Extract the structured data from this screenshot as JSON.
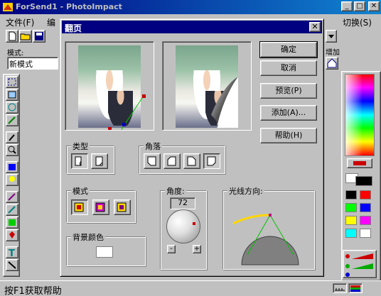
{
  "app": {
    "title": "ForSend1 - PhotoImpact",
    "window_controls": {
      "minimize": "_",
      "maximize": "□",
      "close": "✕"
    }
  },
  "menubar": {
    "items": [
      "文件(F)",
      "编"
    ],
    "right_item": "切换(S)"
  },
  "mode": {
    "label": "模式:",
    "value": "新模式"
  },
  "toolbar_right_label": "增加",
  "dialog": {
    "title": "翻页",
    "buttons": {
      "ok": "确定",
      "cancel": "取消",
      "preview": "预览(P)",
      "add": "添加(A)...",
      "help": "帮助(H)"
    },
    "groups": {
      "type": "类型",
      "corner": "角落",
      "mode": "模式",
      "angle": "角度:",
      "light_direction": "光线方向:",
      "bg_color": "背景颜色"
    },
    "angle_value": "72",
    "minus": "-",
    "plus": "+"
  },
  "statusbar": {
    "text": "按F1获取帮助"
  },
  "colors": {
    "titlebar": "#000080",
    "swatches": [
      "#000000",
      "#ff0000",
      "#00ff00",
      "#0000ff",
      "#ffff00",
      "#ff00ff",
      "#00ffff",
      "#ffffff"
    ]
  }
}
